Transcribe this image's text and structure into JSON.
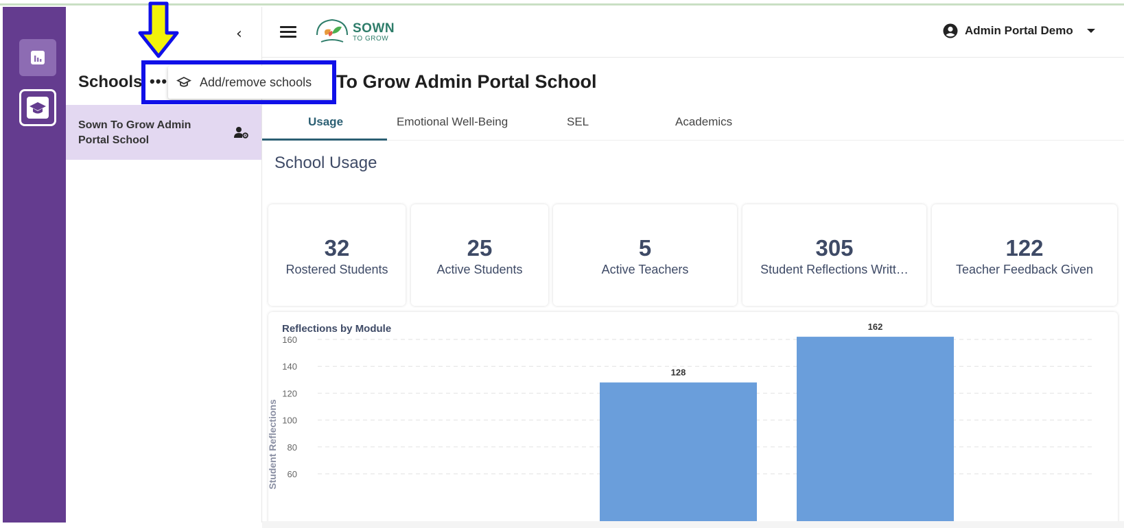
{
  "sidebar_panel": {
    "title": "Schools",
    "more_label": "•••",
    "collapse_label": "‹",
    "school_item": "Sown To Grow Admin Portal School",
    "menu_item": "Add/remove schools"
  },
  "header": {
    "logo_text": "SOWN",
    "logo_sub": "TO GROW",
    "account_name": "Admin Portal Demo"
  },
  "main": {
    "title": "To Grow Admin Portal School",
    "tabs": [
      "Usage",
      "Emotional Well-Being",
      "SEL",
      "Academics"
    ],
    "active_tab": "Usage",
    "section_title": "School Usage",
    "stats": [
      {
        "value": "32",
        "label": "Rostered Students"
      },
      {
        "value": "25",
        "label": "Active Students"
      },
      {
        "value": "5",
        "label": "Active Teachers"
      },
      {
        "value": "305",
        "label": "Student Reflections Writt…"
      },
      {
        "value": "122",
        "label": "Teacher Feedback Given"
      }
    ]
  },
  "colors": {
    "rail": "#643c8f",
    "selected_item": "#e3d8f1",
    "bar": "#6a9edb",
    "accent": "#2b5f73",
    "annotation_box": "#1010e8",
    "annotation_arrow": "#f2f20a"
  },
  "chart_data": {
    "type": "bar",
    "title": "Reflections by Module",
    "ylabel": "Student Reflections",
    "yticks": [
      60,
      80,
      100,
      120,
      140,
      160
    ],
    "ylim": [
      40,
      170
    ],
    "grid": true,
    "bars": [
      {
        "value": 128,
        "label": "128"
      },
      {
        "value": 162,
        "label": "162"
      }
    ]
  }
}
